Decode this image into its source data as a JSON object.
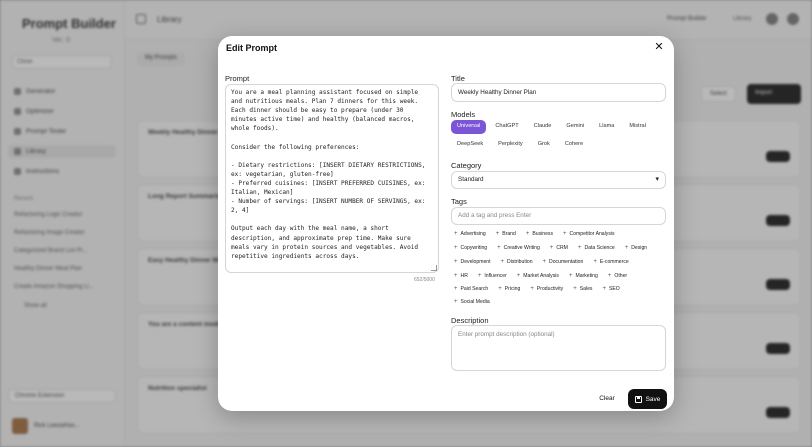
{
  "background": {
    "brand": "Prompt Builder",
    "version": "Ver. 0",
    "side_select": "Close",
    "nav": [
      "Generator",
      "Optimizer",
      "Prompt Tester",
      "Library",
      "Instructions"
    ],
    "recent_label": "Recent",
    "recent": [
      "Refactoring Logic Creator",
      "Refactoring Image Creator",
      "Categorized Brand List Pr...",
      "Healthy Dinner Meal Plan",
      "Create Amazon Shopping Li..."
    ],
    "show_all": "Show all",
    "extension": "Chrome Extension",
    "user": "Rick Leeuwhas...",
    "crumb": "Library",
    "top_right_1": "Prompt Builder",
    "top_right_2": "Library",
    "tab": "My Prompts",
    "btn_select": "Select",
    "btn_import": "Import",
    "cards": [
      "Weekly Healthy Dinner Plan",
      "Long Report Summarizer",
      "Easy Healthy Dinner Meal Plan",
      "You are a content moderator...",
      "Nutrition specialist"
    ]
  },
  "modal": {
    "title": "Edit Prompt",
    "prompt_label": "Prompt",
    "prompt_text": "You are a meal planning assistant focused on simple\nand nutritious meals. Plan 7 dinners for this week.\nEach dinner should be easy to prepare (under 30\nminutes active time) and healthy (balanced macros,\nwhole foods).\n\nConsider the following preferences:\n\n- Dietary restrictions: [INSERT DIETARY RESTRICTIONS,\nex: vegetarian, gluten-free]\n- Preferred cuisines: [INSERT PREFERRED CUISINES, ex:\nItalian, Mexican]\n- Number of servings: [INSERT NUMBER OF SERVINGS, ex:\n2, 4]\n\nOutput each day with the meal name, a short\ndescription, and approximate prep time. Make sure\nmeals vary in protein sources and vegetables. Avoid\nrepetitive ingredients across days.",
    "char_count": "652/5000",
    "title_label": "Title",
    "title_value": "Weekly Healthy Dinner Plan",
    "models_label": "Models",
    "models_row1": [
      "Universal",
      "ChatGPT",
      "Claude",
      "Gemini",
      "Llama",
      "Mistral"
    ],
    "models_row2": [
      "DeepSeek",
      "Perplexity",
      "Grok",
      "Cohere"
    ],
    "selected_model": "Universal",
    "category_label": "Category",
    "category_value": "Standard",
    "tags_label": "Tags",
    "tags_placeholder": "Add a tag and press Enter",
    "tags_rows": [
      [
        "Advertising",
        "Brand",
        "Business",
        "Competitor Analysis"
      ],
      [
        "Copywriting",
        "Creative Writing",
        "CRM",
        "Data Science",
        "Design"
      ],
      [
        "Development",
        "Distribution",
        "Documentation",
        "E-commerce"
      ],
      [
        "HR",
        "Influencer",
        "Market Analysis",
        "Marketing",
        "Other"
      ],
      [
        "Paid Search",
        "Pricing",
        "Productivity",
        "Sales",
        "SEO"
      ],
      [
        "Social Media"
      ]
    ],
    "description_label": "Description",
    "description_placeholder": "Enter prompt description (optional)",
    "clear_label": "Clear",
    "save_label": "Save"
  },
  "colors": {
    "accent": "#7a55d6",
    "primary_button": "#111111"
  }
}
